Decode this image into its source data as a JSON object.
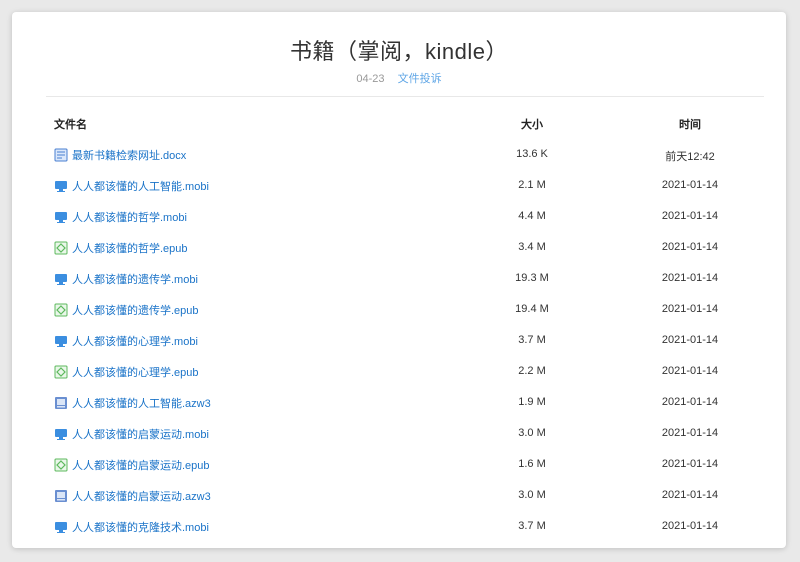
{
  "page": {
    "title": "书籍（掌阅，kindle）",
    "date": "04-23",
    "report_label": "文件投诉"
  },
  "table": {
    "headers": {
      "name": "文件名",
      "size": "大小",
      "time": "时间"
    },
    "rows": [
      {
        "icon": "doc-file-icon",
        "name": "最新书籍检索网址.docx",
        "size": "13.6 K",
        "time": "前天12:42"
      },
      {
        "icon": "mobi-file-icon",
        "name": "人人都该懂的人工智能.mobi",
        "size": "2.1 M",
        "time": "2021-01-14"
      },
      {
        "icon": "mobi-file-icon",
        "name": "人人都该懂的哲学.mobi",
        "size": "4.4 M",
        "time": "2021-01-14"
      },
      {
        "icon": "epub-file-icon",
        "name": "人人都该懂的哲学.epub",
        "size": "3.4 M",
        "time": "2021-01-14"
      },
      {
        "icon": "mobi-file-icon",
        "name": "人人都该懂的遗传学.mobi",
        "size": "19.3 M",
        "time": "2021-01-14"
      },
      {
        "icon": "epub-file-icon",
        "name": "人人都该懂的遗传学.epub",
        "size": "19.4 M",
        "time": "2021-01-14"
      },
      {
        "icon": "mobi-file-icon",
        "name": "人人都该懂的心理学.mobi",
        "size": "3.7 M",
        "time": "2021-01-14"
      },
      {
        "icon": "epub-file-icon",
        "name": "人人都该懂的心理学.epub",
        "size": "2.2 M",
        "time": "2021-01-14"
      },
      {
        "icon": "azw3-file-icon",
        "name": "人人都该懂的人工智能.azw3",
        "size": "1.9 M",
        "time": "2021-01-14"
      },
      {
        "icon": "mobi-file-icon",
        "name": "人人都该懂的启蒙运动.mobi",
        "size": "3.0 M",
        "time": "2021-01-14"
      },
      {
        "icon": "epub-file-icon",
        "name": "人人都该懂的启蒙运动.epub",
        "size": "1.6 M",
        "time": "2021-01-14"
      },
      {
        "icon": "azw3-file-icon",
        "name": "人人都该懂的启蒙运动.azw3",
        "size": "3.0 M",
        "time": "2021-01-14"
      },
      {
        "icon": "mobi-file-icon",
        "name": "人人都该懂的克隆技术.mobi",
        "size": "3.7 M",
        "time": "2021-01-14"
      }
    ]
  }
}
